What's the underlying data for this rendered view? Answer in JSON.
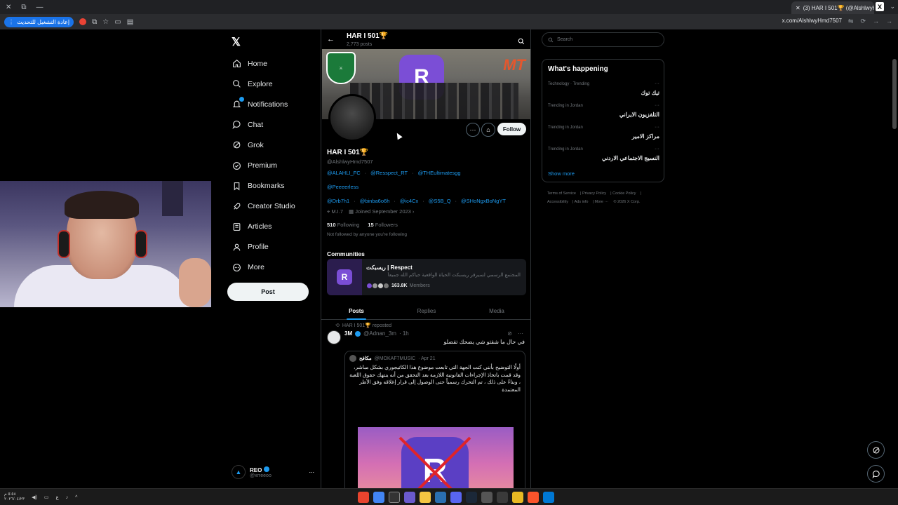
{
  "browser": {
    "tab_title": "(3) HAR I 501🏆 (@AlshlwyHm",
    "new_tab_symbol": "+",
    "x_logo": "X",
    "update_button": "إعادة التشغيل للتحديث",
    "url": "x.com/AlshlwyHmd7507"
  },
  "nav": {
    "logo": "𝕏",
    "items": [
      {
        "label": "Home",
        "icon": "home-icon"
      },
      {
        "label": "Explore",
        "icon": "search-icon"
      },
      {
        "label": "Notifications",
        "icon": "bell-icon"
      },
      {
        "label": "Chat",
        "icon": "chat-icon"
      },
      {
        "label": "Grok",
        "icon": "grok-icon"
      },
      {
        "label": "Premium",
        "icon": "premium-icon"
      },
      {
        "label": "Bookmarks",
        "icon": "bookmark-icon"
      },
      {
        "label": "Creator Studio",
        "icon": "rocket-icon"
      },
      {
        "label": "Articles",
        "icon": "article-icon"
      },
      {
        "label": "Profile",
        "icon": "person-icon"
      },
      {
        "label": "More",
        "icon": "more-circle-icon"
      }
    ],
    "post_button": "Post",
    "account": {
      "name": "REO",
      "handle": "@xrreeoo",
      "more": "..."
    }
  },
  "profile": {
    "header_name": "HAR I 501🏆",
    "header_posts": "2,773 posts",
    "name": "HAR I 501🏆",
    "handle": "@AlshlwyHmd7507",
    "mentions_row1": [
      "@ALAHLI_FC",
      "@Resspect_RT",
      "@THEultimatesgg"
    ],
    "mentions_row2": [
      "@Peeeerless"
    ],
    "mentions_row3": [
      "@Drb7h1",
      "@binba6o6h",
      "@ic4Cx",
      "@S5B_Q",
      "@SHoNgxBoNgYT"
    ],
    "location": "M.I.7",
    "joined": "Joined September 2023",
    "following_count": "510",
    "following_label": "Following",
    "followers_count": "15",
    "followers_label": "Followers",
    "not_followed": "Not followed by anyone you're following",
    "follow_button": "Follow",
    "more_button": "···"
  },
  "communities": {
    "title": "Communities",
    "name": "ريسبكت | Respect",
    "description": "المجتمع الرسمي لسيرفر ريسبكت الحياة الواقعية حياكم الله جميعاً",
    "members_count": "163.8K",
    "members_label": "Members"
  },
  "tabs": [
    "Posts",
    "Replies",
    "Media"
  ],
  "tweet": {
    "reposted_by": "HAR I 501🏆 reposted",
    "author": "3M",
    "author_handle": "@Adnan_3m",
    "time": "· 1h",
    "text": "في حال ما شفتو شي يضحك تفضلو",
    "quote": {
      "author": "مكافح",
      "handle": "@MOKAF7MUSIC",
      "time": "· Apr 21",
      "text": "أولًا التوضيح بأنني كنت الجهة التي تابعت موضوع هذا الكاتيجوري بشكل مباشر، وقد قمت باتخاذ الإجراءات القانونية اللازمة بعد التحقق من أنه ينتهك حقوق اللعبة ، وبناءً على ذلك ، تم التحرك رسمياً حتى الوصول إلى قرار إغلاقه وفق الأطر المعتمدة"
    }
  },
  "right": {
    "search_placeholder": "Search",
    "happening_title": "What's happening",
    "trends": [
      {
        "meta": "Technology · Trending",
        "name": "تيك توك"
      },
      {
        "meta": "Trending in Jordan",
        "name": "التلفزيون الايراني"
      },
      {
        "meta": "Trending in Jordan",
        "name": "مراكز الامير"
      },
      {
        "meta": "Trending in Jordan",
        "name": "النسيج الاجتماعي الاردني"
      }
    ],
    "show_more": "Show more",
    "footer": [
      "Terms of Service",
      "Privacy Policy",
      "Cookie Policy",
      "Accessibility",
      "Ads info",
      "More ···",
      "© 2026 X Corp."
    ]
  },
  "taskbar": {
    "clock_time": "٥:٥٨ م",
    "clock_date": "٢٠٢٦/٠٤/٢٣",
    "lang": "ع"
  },
  "colors": {
    "accent": "#1d9bf0",
    "background": "#000000",
    "border": "#2f3336"
  }
}
